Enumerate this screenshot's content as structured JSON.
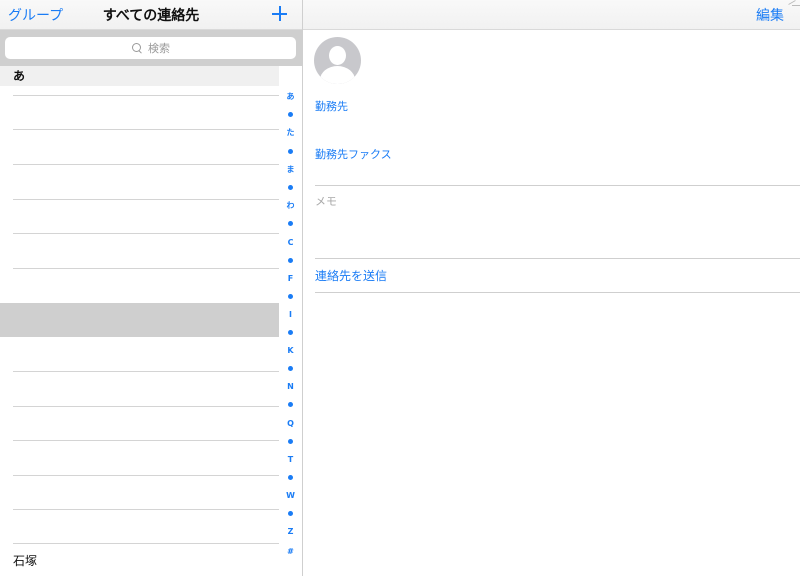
{
  "list_nav": {
    "groups_label": "グループ",
    "title": "すべての連絡先",
    "add_icon": "plus-icon"
  },
  "search": {
    "placeholder": "検索",
    "icon": "search-icon"
  },
  "section": {
    "header": "あ"
  },
  "contacts": {
    "last_visible": "石塚"
  },
  "index_letters": [
    "あ",
    "た",
    "ま",
    "わ",
    "C",
    "F",
    "I",
    "K",
    "N",
    "Q",
    "T",
    "W",
    "Z",
    "#"
  ],
  "detail_nav": {
    "edit_label": "編集"
  },
  "detail": {
    "work_label": "勤務先",
    "work_fax_label": "勤務先ファクス",
    "memo_label": "メモ",
    "send_contact_label": "連絡先を送信"
  },
  "colors": {
    "accent": "#1a7cf5",
    "selected_row": "#cfcfcf"
  }
}
